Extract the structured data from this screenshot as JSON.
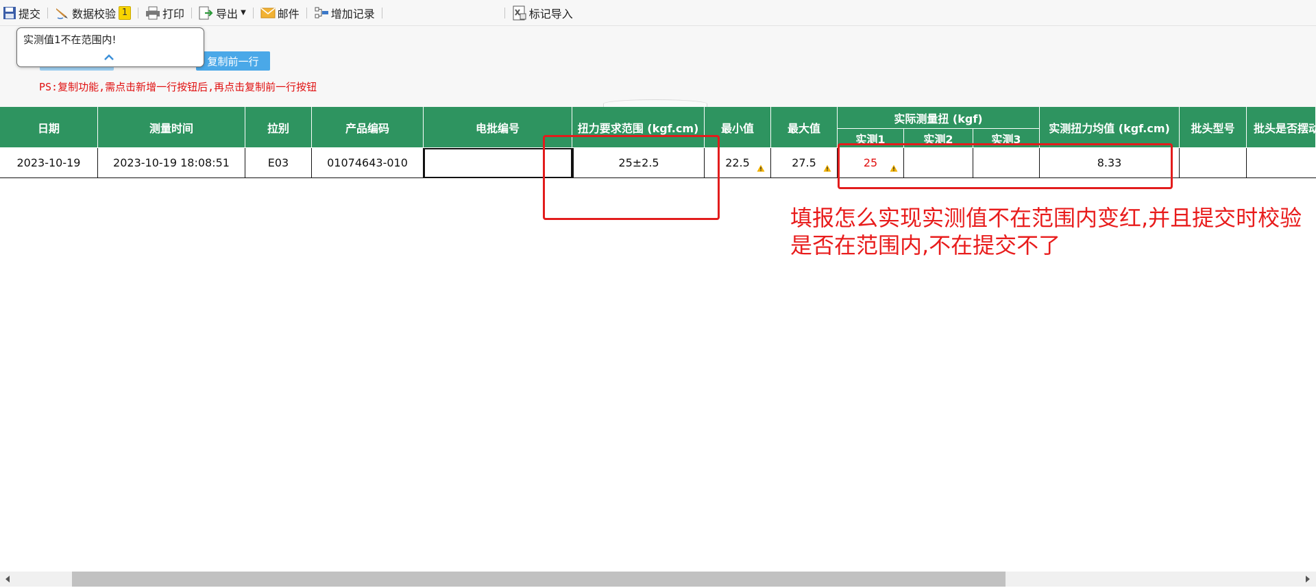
{
  "toolbar": {
    "submit": "提交",
    "validate": "数据校验",
    "validate_badge": "1",
    "print": "打印",
    "export": "导出",
    "mail": "邮件",
    "add_record": "增加记录",
    "mark_import": "标记导入"
  },
  "panel": {
    "tooltip_message": "实测值1不在范围内!",
    "copy_prev_row_button": "复制前一行",
    "ps_note": "PS:复制功能,需点击新增一行按钮后,再点击复制前一行按钮"
  },
  "table": {
    "headers": {
      "date": "日期",
      "measure_time": "测量时间",
      "pull_type": "拉别",
      "product_code": "产品编码",
      "batch_no": "电批编号",
      "torque_range": "扭力要求范围 (kgf.cm)",
      "min": "最小值",
      "max": "最大值",
      "actual_group": "实际测量扭 (kgf)",
      "m1": "实测1",
      "m2": "实测2",
      "m3": "实测3",
      "avg": "实测扭力均值 (kgf.cm)",
      "bit_model": "批头型号",
      "bit_swing": "批头是否摆动"
    },
    "row": {
      "date": "2023-10-19",
      "measure_time": "2023-10-19 18:08:51",
      "pull_type": "E03",
      "product_code": "01074643-010",
      "batch_no": "",
      "torque_range": "25±2.5",
      "min": "22.5",
      "max": "27.5",
      "m1": "25",
      "m2": "",
      "m3": "",
      "avg": "8.33",
      "bit_model": "",
      "bit_swing": ""
    }
  },
  "annotation": {
    "text": "填报怎么实现实测值不在范围内变红,并且提交时校验是否在范围内,不在提交不了"
  },
  "colors": {
    "header_green": "#2e9460",
    "annotation_red": "#e21c1c",
    "button_blue": "#4aa8e8"
  }
}
